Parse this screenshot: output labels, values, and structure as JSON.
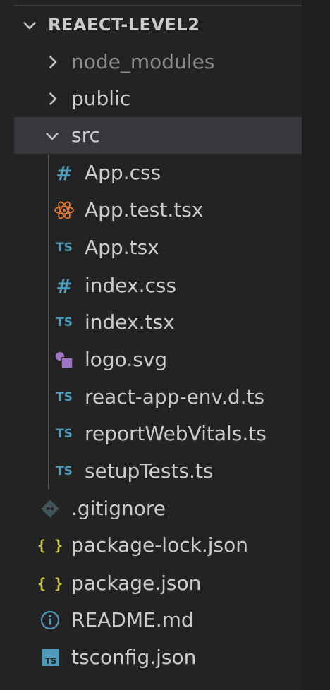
{
  "explorer": {
    "root": {
      "label": "REAECT-LEVEL2",
      "expanded": true
    },
    "items": [
      {
        "label": "node_modules",
        "type": "folder",
        "expanded": false,
        "dimmed": true,
        "icon": "chevron-right-icon"
      },
      {
        "label": "public",
        "type": "folder",
        "expanded": false,
        "icon": "chevron-right-icon"
      },
      {
        "label": "src",
        "type": "folder",
        "expanded": true,
        "selected": true,
        "icon": "chevron-down-icon"
      },
      {
        "label": "App.css",
        "type": "file",
        "icon": "css-hash-icon",
        "parent": "src"
      },
      {
        "label": "App.test.tsx",
        "type": "file",
        "icon": "react-atom-icon",
        "parent": "src"
      },
      {
        "label": "App.tsx",
        "type": "file",
        "icon": "typescript-icon",
        "icon_text": "TS",
        "parent": "src"
      },
      {
        "label": "index.css",
        "type": "file",
        "icon": "css-hash-icon",
        "parent": "src"
      },
      {
        "label": "index.tsx",
        "type": "file",
        "icon": "typescript-icon",
        "icon_text": "TS",
        "parent": "src"
      },
      {
        "label": "logo.svg",
        "type": "file",
        "icon": "svg-file-icon",
        "parent": "src"
      },
      {
        "label": "react-app-env.d.ts",
        "type": "file",
        "icon": "typescript-icon",
        "icon_text": "TS",
        "parent": "src"
      },
      {
        "label": "reportWebVitals.ts",
        "type": "file",
        "icon": "typescript-icon",
        "icon_text": "TS",
        "parent": "src"
      },
      {
        "label": "setupTests.ts",
        "type": "file",
        "icon": "typescript-icon",
        "icon_text": "TS",
        "parent": "src"
      },
      {
        "label": ".gitignore",
        "type": "file",
        "icon": "git-icon"
      },
      {
        "label": "package-lock.json",
        "type": "file",
        "icon": "json-braces-icon",
        "icon_text": "{ }"
      },
      {
        "label": "package.json",
        "type": "file",
        "icon": "json-braces-icon",
        "icon_text": "{ }"
      },
      {
        "label": "README.md",
        "type": "file",
        "icon": "info-icon"
      },
      {
        "label": "tsconfig.json",
        "type": "file",
        "icon": "tsconfig-icon",
        "icon_text": "TS"
      }
    ]
  },
  "colors": {
    "background": "#232323",
    "selected_row": "#37373d",
    "text": "#cccccc",
    "dimmed_text": "#8c8c8c",
    "css_icon": "#519aba",
    "ts_icon": "#519aba",
    "react_icon": "#e37933",
    "svg_icon": "#a074c4",
    "json_icon": "#cbcb41",
    "git_icon": "#41535b",
    "info_icon": "#519aba"
  }
}
